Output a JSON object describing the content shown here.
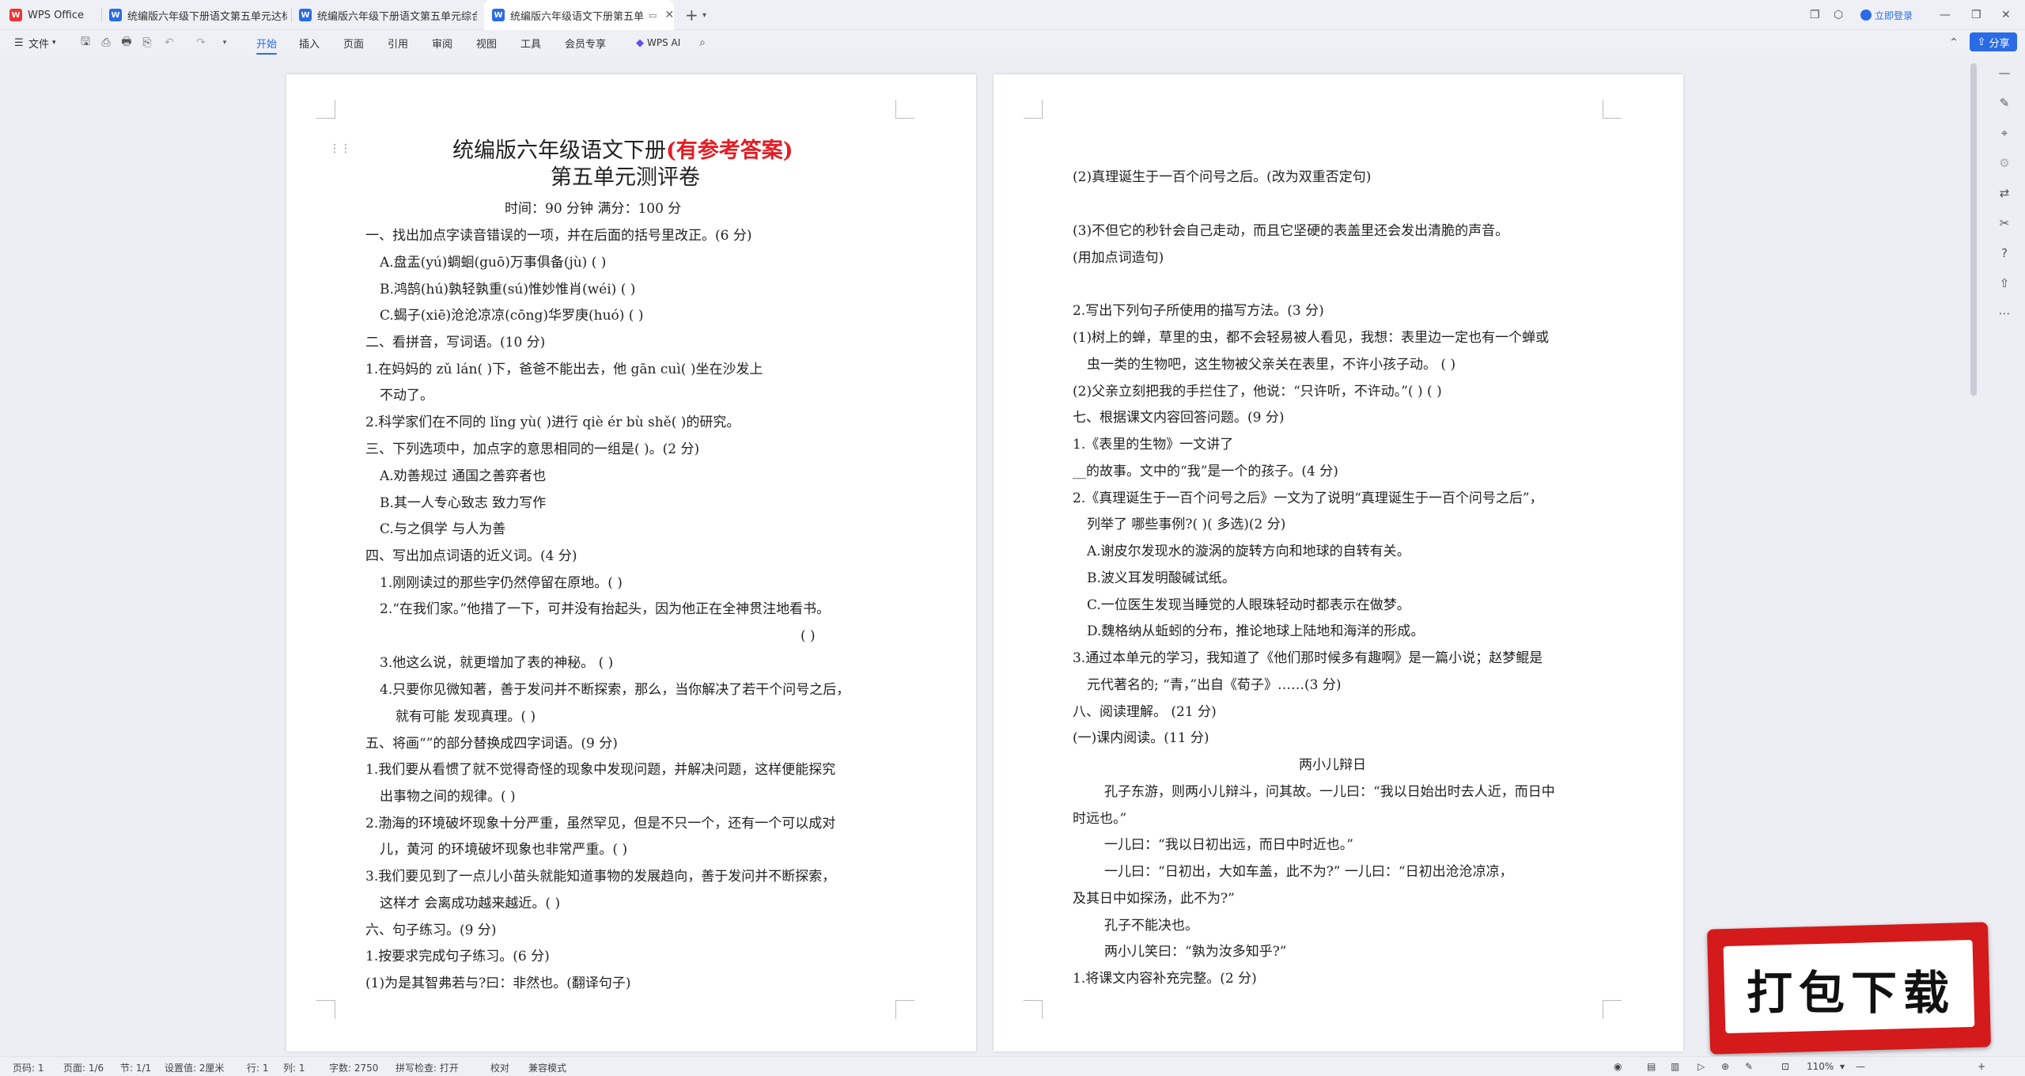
{
  "tabbar": {
    "tabs": [
      {
        "label": "WPS Office"
      },
      {
        "label": "统编版六年级下册语文第五单元达标"
      },
      {
        "label": "统编版六年级下册语文第五单元综合"
      },
      {
        "label": "统编版六年级语文下册第五单"
      }
    ],
    "login": "立即登录"
  },
  "toolbar": {
    "file": "文件",
    "menus": [
      "开始",
      "插入",
      "页面",
      "引用",
      "审阅",
      "视图",
      "工具",
      "会员专享"
    ],
    "wps_ai": "WPS AI",
    "share": "分享"
  },
  "page1": {
    "title_main": "统编版六年级语文下册",
    "title_red": "(有参考答案)",
    "title2": "第五单元测评卷",
    "lines": [
      "时间：90 分钟 满分：100 分",
      "一、找出加点字读音错误的一项，并在后面的括号里改正。(6 分)",
      "A.盘盂(yú)蜩蛔(guō)万事俱备(jù) ( )",
      "B.鸿鹄(hú)孰轻孰重(sú)惟妙惟肖(wéi) ( )",
      "C.蝎子(xiē)沧沧凉凉(cōng)华罗庚(huó) ( )",
      "二、看拼音，写词语。(10 分)",
      "1.在妈妈的 zǔ lán( )下，爸爸不能出去，他 gān cuì( )坐在沙发上",
      "不动了。",
      "2.科学家们在不同的 lǐng yù( )进行 qiè ér bù shě( )的研究。",
      "三、下列选项中，加点字的意思相同的一组是( )。(2 分)",
      "A.劝善规过 通国之善弈者也",
      "B.其一人专心致志 致力写作",
      "C.与之俱学 与人为善",
      "四、写出加点词语的近义词。(4 分)",
      "1.刚刚读过的那些字仍然停留在原地。( )",
      "2.“在我们家。”他措了一下，可并没有抬起头，因为他正在全神贯注地看书。",
      "( )",
      "3.他这么说，就更增加了表的神秘。 ( )",
      "4.只要你见微知著，善于发问并不断探索，那么，当你解决了若干个问号之后，",
      "就有可能 发现真理。( )",
      "五、将画“”的部分替换成四字词语。(9 分)",
      "1.我们要从看惯了就不觉得奇怪的现象中发现问题，并解决问题，这样便能探究",
      "出事物之间的规律。( )",
      "2.渤海的环境破坏现象十分严重，虽然罕见，但是不只一个，还有一个可以成对",
      "儿，黄河 的环境破坏现象也非常严重。( )",
      "3.我们要见到了一点儿小苗头就能知道事物的发展趋向，善于发问并不断探索，",
      "这样才 会离成功越来越近。( )",
      "六、句子练习。(9 分)",
      "1.按要求完成句子练习。(6 分)",
      "(1)为是其智弗若与?曰：非然也。(翻译句子)"
    ]
  },
  "page2": {
    "lines": [
      "(2)真理诞生于一百个问号之后。(改为双重否定句)",
      "",
      "(3)不但它的秒针会自己走动，而且它坚硬的表盖里还会发出清脆的声音。",
      "(用加点词造句)",
      "",
      "2.写出下列句子所使用的描写方法。(3 分)",
      "(1)树上的蝉，草里的虫，都不会轻易被人看见，我想：表里边一定也有一个蝉或",
      "虫一类的生物吧，这生物被父亲关在表里，不许小孩子动。 ( )",
      "(2)父亲立刻把我的手拦住了，他说：“只许听，不许动。”( ) ( )",
      "七、根据课文内容回答问题。(9 分)",
      "1.《表里的生物》一文讲了",
      "__的故事。文中的“我”是一个的孩子。(4 分)",
      "2.《真理诞生于一百个问号之后》一文为了说明“真理诞生于一百个问号之后”，",
      "列举了 哪些事例?( )( 多选)(2 分)",
      "A.谢皮尔发现水的漩涡的旋转方向和地球的自转有关。",
      "B.波义耳发明酸碱试纸。",
      "C.一位医生发现当睡觉的人眼珠轻动时都表示在做梦。",
      "D.魏格纳从蚯蚓的分布，推论地球上陆地和海洋的形成。",
      "3.通过本单元的学习，我知道了《他们那时候多有趣啊》是一篇小说；赵梦鲲是",
      "元代著名的; “青，”出自《荀子》……(3 分)",
      "八、阅读理解。 (21 分)",
      "(一)课内阅读。(11 分)",
      "两小儿辩日",
      "孔子东游，则两小儿辩斗，问其故。一儿曰：“我以日始出时去人近，而日中",
      "时远也。”",
      "一儿曰：“我以日初出远，而日中时近也。”",
      "一儿曰：“日初出，大如车盖，此不为?” 一儿曰：“日初出沧沧凉凉，",
      "及其日中如探汤，此不为?”",
      "孔子不能决也。",
      "两小儿笑曰：“孰为汝多知乎?”",
      "1.将课文内容补充完整。(2 分)"
    ]
  },
  "status": {
    "page": "页码: 1",
    "pages": "页面: 1/6",
    "section": "节: 1/1",
    "setting": "设置值: 2厘米",
    "row": "行: 1",
    "col": "列: 1",
    "words": "字数: 2750",
    "spell": "拼写检查: 打开",
    "proof": "校对",
    "compat": "兼容模式",
    "zoom": "110%"
  },
  "banner": {
    "text": "打包下载"
  }
}
